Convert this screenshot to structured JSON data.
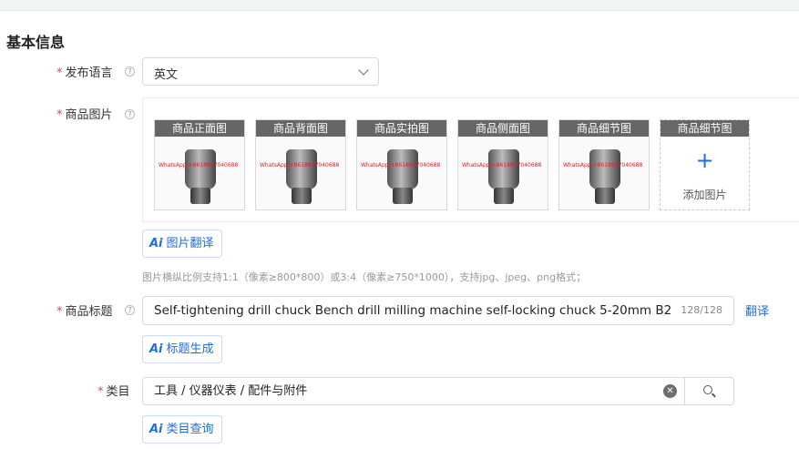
{
  "section_title": "基本信息",
  "language": {
    "label": "发布语言",
    "value": "英文"
  },
  "images": {
    "label": "商品图片",
    "items": [
      {
        "caption": "商品正面图",
        "watermark": "WhatsApp:+8618817040688"
      },
      {
        "caption": "商品背面图",
        "watermark": "WhatsApp:+8618817040688"
      },
      {
        "caption": "商品实拍图",
        "watermark": "WhatsApp:+8618817040688"
      },
      {
        "caption": "商品侧面图",
        "watermark": "WhatsApp:+8618817040688"
      },
      {
        "caption": "商品细节图",
        "watermark": "WhatsApp:+8618817040688"
      }
    ],
    "add_caption": "商品细节图",
    "add_label": "添加图片",
    "translate_button": "图片翻译",
    "hint": "图片横纵比例支持1:1（像素≥800*800）或3:4（像素≥750*1000），支持jpg、jpeg、png格式；"
  },
  "title": {
    "label": "商品标题",
    "value": "Self-tightening drill chuck Bench drill milling machine self-locking chuck 5-20mm B2",
    "count": "128/128",
    "translate_link": "翻译",
    "generate_button": "标题生成"
  },
  "category": {
    "label": "类目",
    "value": "工具 / 仪器仪表 / 配件与附件",
    "query_button": "类目查询"
  },
  "ai_badge": "Ai",
  "help_glyph": "?",
  "colors": {
    "accent": "#1f6fd6",
    "required": "#e5484d"
  }
}
